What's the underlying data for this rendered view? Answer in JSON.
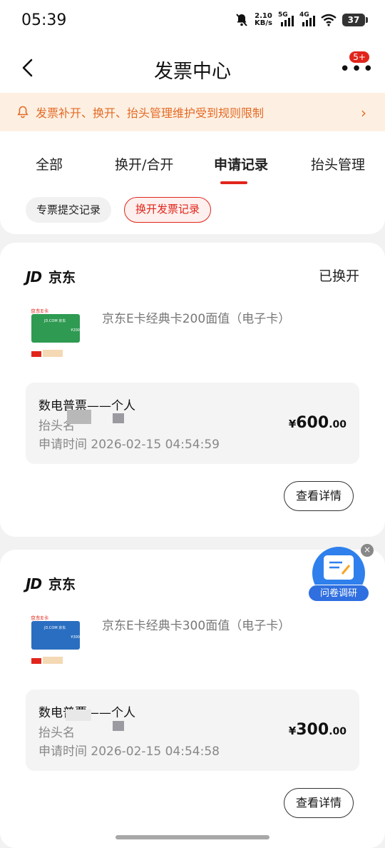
{
  "status_bar": {
    "time": "05:39",
    "net_speed_value": "2.10",
    "net_speed_unit": "KB/s",
    "sig1_label": "5G",
    "sig2_label": "4G",
    "battery": "37"
  },
  "nav": {
    "title": "发票中心",
    "badge": "5+"
  },
  "notice": {
    "text": "发票补开、换开、抬头管理维护受到规则限制"
  },
  "tabs": [
    {
      "label": "全部"
    },
    {
      "label": "换开/合开"
    },
    {
      "label": "申请记录"
    },
    {
      "label": "抬头管理"
    }
  ],
  "active_tab": "申请记录",
  "chips": [
    {
      "label": "专票提交记录"
    },
    {
      "label": "换开发票记录"
    }
  ],
  "records": [
    {
      "shop_logo": "JD",
      "shop": "京东",
      "status": "已换开",
      "product": "京东E卡经典卡200面值（电子卡）",
      "card_color": "#2f9a52",
      "invoice_type": "数电普票——个人",
      "header_label": "抬头名",
      "time_label": "申请时间 2026-02-15 04:54:59",
      "price_currency": "¥",
      "price_int": "600",
      "price_dec": ".00",
      "detail_label": "查看详情"
    },
    {
      "shop_logo": "JD",
      "shop": "京东",
      "status": "",
      "product": "京东E卡经典卡300面值（电子卡）",
      "card_color": "#2a6ec1",
      "invoice_type": "数电普票——个人",
      "header_label": "抬头名",
      "time_label": "申请时间 2026-02-15 04:54:58",
      "price_currency": "¥",
      "price_int": "300",
      "price_dec": ".00",
      "detail_label": "查看详情"
    }
  ],
  "survey": {
    "label": "问卷调研"
  },
  "colors": {
    "accent": "#e1251b",
    "notice_text": "#e46a26",
    "notice_bg": "#fdf0e2"
  }
}
